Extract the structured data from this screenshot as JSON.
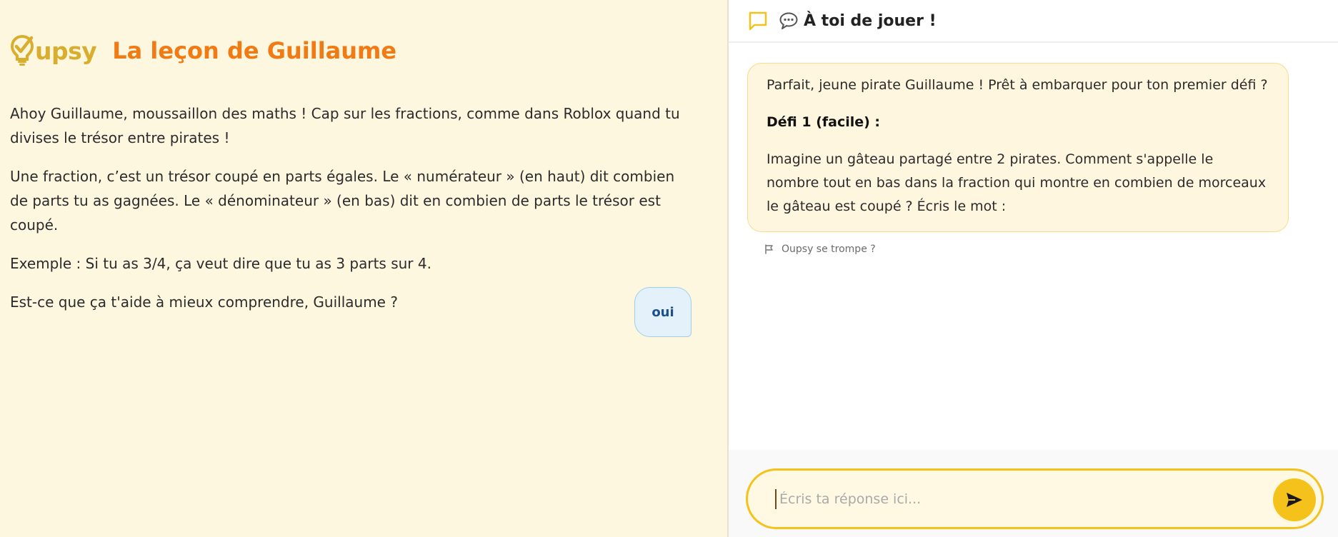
{
  "brand": {
    "name": "upsy",
    "logo_color": "#d9ad2e"
  },
  "lesson": {
    "title": "La leçon de Guillaume",
    "paragraphs": [
      "Ahoy Guillaume, moussaillon des maths ! Cap sur les fractions, comme dans Roblox quand tu divises le trésor entre pirates !",
      "Une fraction, c’est un trésor coupé en parts égales. Le « numérateur » (en haut) dit combien de parts tu as gagnées. Le « dénominateur » (en bas) dit en combien de parts le trésor est coupé.",
      "Exemple : Si tu as 3/4, ça veut dire que tu as 3 parts sur 4.",
      "Est-ce que ça t'aide à mieux comprendre, Guillaume ?"
    ],
    "user_answer": "oui",
    "title_color": "#f07a14"
  },
  "chat": {
    "header_title": "À toi de jouer !",
    "header_icon": "chat-bubble-icon",
    "header_emoji": "speech-balloon-icon",
    "bot_message": {
      "intro": "Parfait, jeune pirate Guillaume ! Prêt à embarquer pour ton premier défi ?",
      "challenge_title": "Défi 1 (facile) :",
      "challenge_text": "Imagine un gâteau partagé entre 2 pirates. Comment s'appelle le nombre tout en bas dans la fraction qui montre en combien de morceaux le gâteau est coupé ? Écris le mot :"
    },
    "report_label": "Oupsy se trompe ?",
    "report_icon": "flag-icon",
    "input": {
      "placeholder": "Écris ta réponse ici...",
      "value": ""
    },
    "send_icon": "send-icon",
    "accent_color": "#f5c21b"
  }
}
